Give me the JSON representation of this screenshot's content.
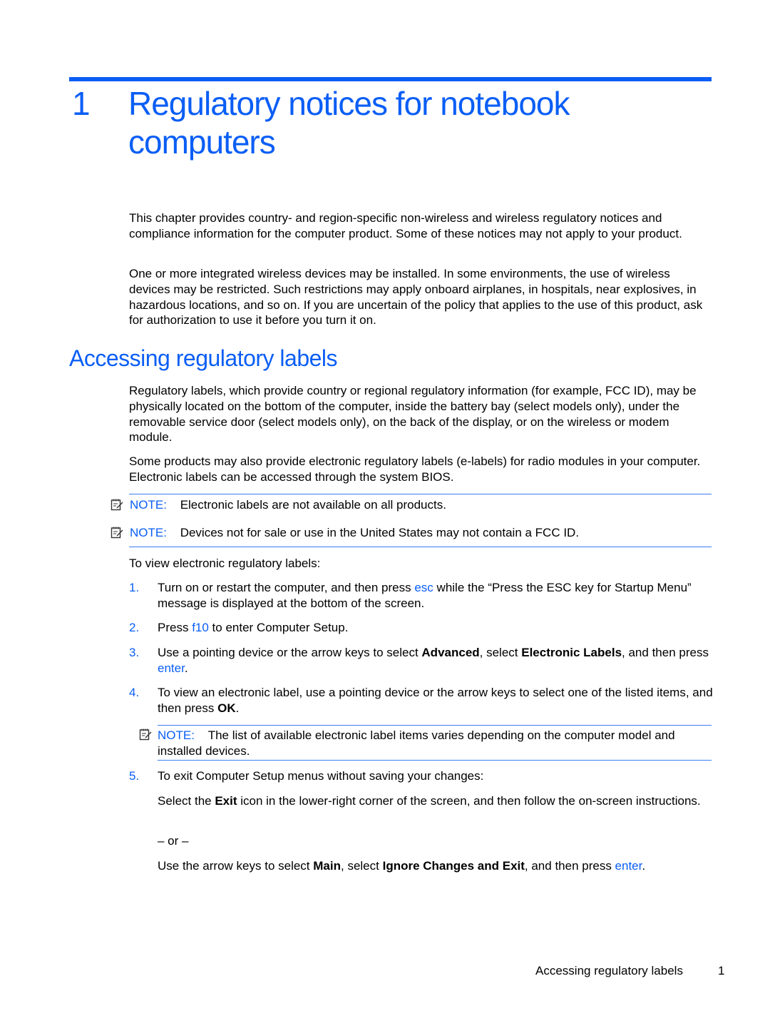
{
  "chapter": {
    "number": "1",
    "title": "Regulatory notices for notebook computers"
  },
  "intro": {
    "p1": "This chapter provides country- and region-specific non-wireless and wireless regulatory notices and compliance information for the computer product. Some of these notices may not apply to your product.",
    "p2": "One or more integrated wireless devices may be installed. In some environments, the use of wireless devices may be restricted. Such restrictions may apply onboard airplanes, in hospitals, near explosives, in hazardous locations, and so on. If you are uncertain of the policy that applies to the use of this product, ask for authorization to use it before you turn it on."
  },
  "section": {
    "heading": "Accessing regulatory labels",
    "p1": "Regulatory labels, which provide country or regional regulatory information (for example, FCC ID), may be physically located on the bottom of the computer, inside the battery bay (select models only), under the removable service door (select models only), on the back of the display, or on the wireless or modem module.",
    "p2": "Some products may also provide electronic regulatory labels (e-labels) for radio modules in your computer. Electronic labels can be accessed through the system BIOS.",
    "notes": [
      {
        "label": "NOTE:",
        "text": "Electronic labels are not available on all products."
      },
      {
        "label": "NOTE:",
        "text": "Devices not for sale or use in the United States may not contain a FCC ID."
      }
    ],
    "steps_intro": "To view electronic regulatory labels:",
    "steps": [
      {
        "num": "1.",
        "t1": "Turn on or restart the computer, and then press ",
        "k1": "esc",
        "t2": " while the “Press the ESC key for Startup Menu” message is displayed at the bottom of the screen."
      },
      {
        "num": "2.",
        "t1": "Press ",
        "k1": "f10",
        "t2": " to enter Computer Setup."
      },
      {
        "num": "3.",
        "t1": "Use a pointing device or the arrow keys to select ",
        "b1": "Advanced",
        "t2": ", select ",
        "b2": "Electronic Labels",
        "t3": ", and then press ",
        "k1": "enter",
        "t4": "."
      },
      {
        "num": "4.",
        "t1": "To view an electronic label, use a pointing device or the arrow keys to select one of the listed items, and then press ",
        "b1": "OK",
        "t2": "."
      },
      {
        "num": "5.",
        "t1": "To exit Computer Setup menus without saving your changes:"
      }
    ],
    "step4_note": {
      "label": "NOTE:",
      "text": "The list of available electronic label items varies depending on the computer model and installed devices."
    },
    "step5": {
      "a_t1": "Select the ",
      "a_b1": "Exit",
      "a_t2": " icon in the lower-right corner of the screen, and then follow the on-screen instructions.",
      "or": "– or –",
      "b_t1": "Use the arrow keys to select ",
      "b_b1": "Main",
      "b_t2": ", select ",
      "b_b2": "Ignore Changes and Exit",
      "b_t3": ", and then press ",
      "b_k1": "enter",
      "b_t4": "."
    }
  },
  "footer": {
    "section_title": "Accessing regulatory labels",
    "page_number": "1"
  }
}
